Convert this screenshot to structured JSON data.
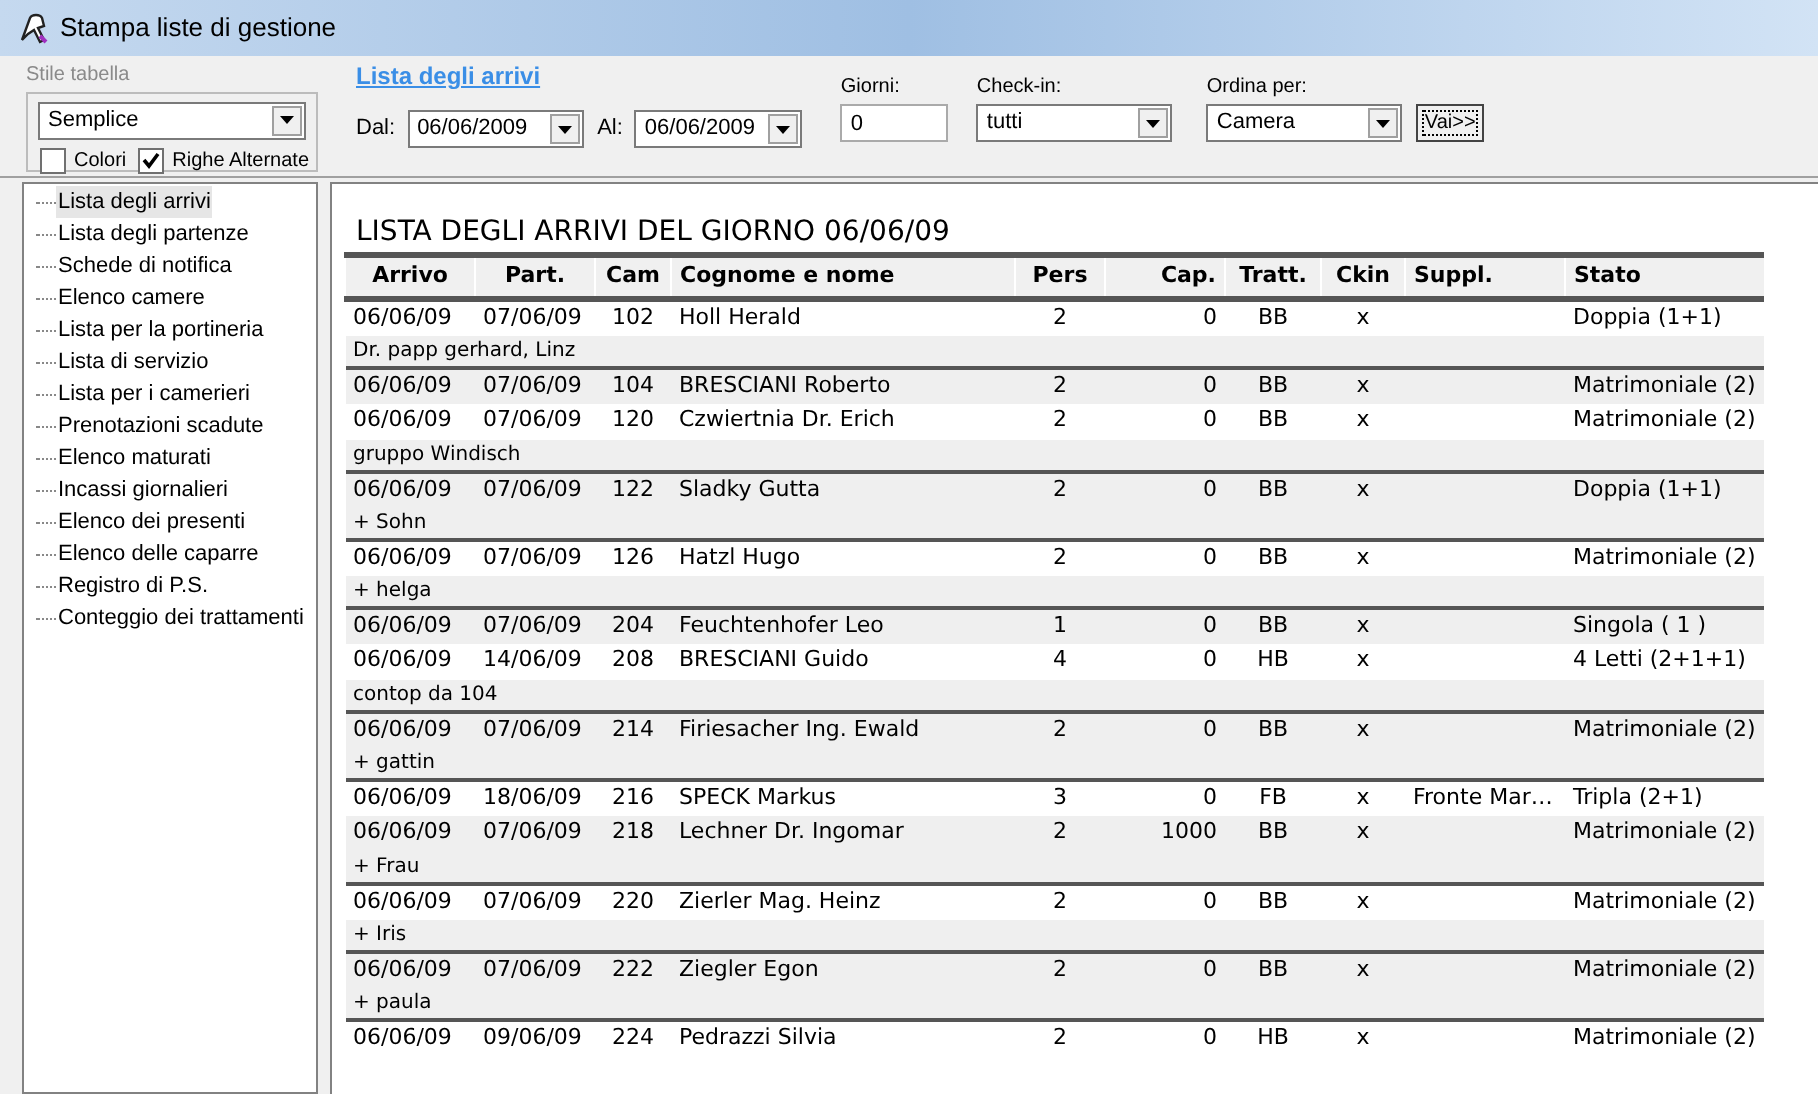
{
  "window": {
    "title": "Stampa liste di gestione"
  },
  "table_style": {
    "legend": "Stile tabella",
    "style": "Semplice",
    "options": [
      {
        "label": "Colori",
        "checked": false
      },
      {
        "label": "Righe Alternate",
        "checked": true
      }
    ]
  },
  "filter": {
    "link": "Lista degli arrivi",
    "from_label": "Dal:",
    "from": "06/06/2009",
    "to_label": "Al:",
    "to": "06/06/2009",
    "days_label": "Giorni:",
    "days": "0",
    "checkin_label": "Check-in:",
    "checkin": "tutti",
    "sort_label": "Ordina per:",
    "sort": "Camera",
    "go_button": "Vai>>"
  },
  "tree": {
    "items": [
      {
        "label": "Lista degli arrivi",
        "selected": true
      },
      {
        "label": "Lista degli partenze",
        "selected": false
      },
      {
        "label": "Schede di notifica",
        "selected": false
      },
      {
        "label": "Elenco camere",
        "selected": false
      },
      {
        "label": "Lista per la portineria",
        "selected": false
      },
      {
        "label": "Lista di servizio",
        "selected": false
      },
      {
        "label": "Lista per i camerieri",
        "selected": false
      },
      {
        "label": "Prenotazioni scadute",
        "selected": false
      },
      {
        "label": "Elenco maturati",
        "selected": false
      },
      {
        "label": "Incassi giornalieri",
        "selected": false
      },
      {
        "label": "Elenco dei presenti",
        "selected": false
      },
      {
        "label": "Elenco delle caparre",
        "selected": false
      },
      {
        "label": "Registro di P.S.",
        "selected": false
      },
      {
        "label": "Conteggio dei trattamenti",
        "selected": false
      }
    ]
  },
  "report": {
    "title": "LISTA DEGLI ARRIVI DEL GIORNO 06/06/09",
    "columns": [
      "Arrivo",
      "Part.",
      "Cam",
      "Cognome e nome",
      "Pers",
      "Cap.",
      "Tratt.",
      "Ckin",
      "Suppl.",
      "Stato"
    ],
    "rows": [
      {
        "cells": [
          "06/06/09",
          "07/06/09",
          "102",
          "Holl Herald",
          "2",
          "0",
          "BB",
          "x",
          "",
          "Doppia (1+1)"
        ],
        "note": "Dr. papp gerhard, Linz"
      },
      {
        "cells": [
          "06/06/09",
          "07/06/09",
          "104",
          "BRESCIANI Roberto",
          "2",
          "0",
          "BB",
          "x",
          "",
          "Matrimoniale (2)"
        ]
      },
      {
        "cells": [
          "06/06/09",
          "07/06/09",
          "120",
          "Czwiertnia Dr. Erich",
          "2",
          "0",
          "BB",
          "x",
          "",
          "Matrimoniale (2)"
        ],
        "note": "gruppo Windisch"
      },
      {
        "cells": [
          "06/06/09",
          "07/06/09",
          "122",
          "Sladky Gutta",
          "2",
          "0",
          "BB",
          "x",
          "",
          "Doppia (1+1)"
        ],
        "note": "+ Sohn"
      },
      {
        "cells": [
          "06/06/09",
          "07/06/09",
          "126",
          "Hatzl Hugo",
          "2",
          "0",
          "BB",
          "x",
          "",
          "Matrimoniale (2)"
        ],
        "note": "+ helga"
      },
      {
        "cells": [
          "06/06/09",
          "07/06/09",
          "204",
          "Feuchtenhofer Leo",
          "1",
          "0",
          "BB",
          "x",
          "",
          "Singola ( 1 )"
        ]
      },
      {
        "cells": [
          "06/06/09",
          "14/06/09",
          "208",
          "BRESCIANI Guido",
          "4",
          "0",
          "HB",
          "x",
          "",
          "4 Letti (2+1+1)"
        ],
        "note": "contop da 104"
      },
      {
        "cells": [
          "06/06/09",
          "07/06/09",
          "214",
          "Firiesacher Ing. Ewald",
          "2",
          "0",
          "BB",
          "x",
          "",
          "Matrimoniale (2)"
        ],
        "note": "+ gattin"
      },
      {
        "cells": [
          "06/06/09",
          "18/06/09",
          "216",
          "SPECK Markus",
          "3",
          "0",
          "FB",
          "x",
          "Fronte Mar…",
          "Tripla (2+1)"
        ]
      },
      {
        "cells": [
          "06/06/09",
          "07/06/09",
          "218",
          "Lechner Dr. Ingomar",
          "2",
          "1000",
          "BB",
          "x",
          "",
          "Matrimoniale (2)"
        ],
        "note": "+ Frau"
      },
      {
        "cells": [
          "06/06/09",
          "07/06/09",
          "220",
          "Zierler Mag. Heinz",
          "2",
          "0",
          "BB",
          "x",
          "",
          "Matrimoniale (2)"
        ],
        "note": "+ Iris"
      },
      {
        "cells": [
          "06/06/09",
          "07/06/09",
          "222",
          "Ziegler Egon",
          "2",
          "0",
          "BB",
          "x",
          "",
          "Matrimoniale (2)"
        ],
        "note": "+ paula"
      },
      {
        "cells": [
          "06/06/09",
          "09/06/09",
          "224",
          "Pedrazzi Silvia",
          "2",
          "0",
          "HB",
          "x",
          "",
          "Matrimoniale (2)"
        ]
      }
    ]
  }
}
